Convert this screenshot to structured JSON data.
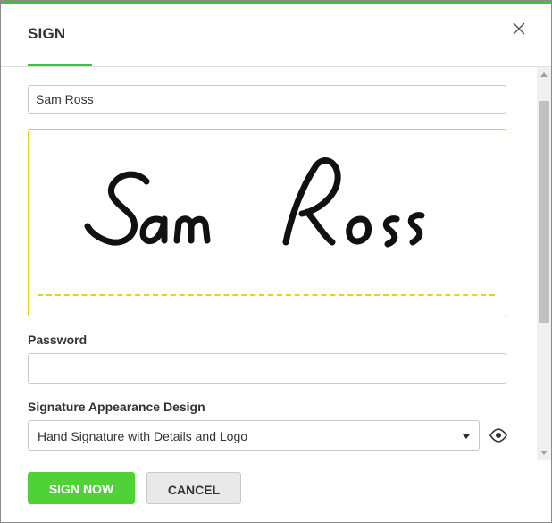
{
  "dialog": {
    "title": "SIGN",
    "close_icon": "close-icon",
    "accent_color": "#3cc33c"
  },
  "signer": {
    "name_value": "Sam Ross"
  },
  "signature_pad": {
    "rendered_text": "Sam Ross",
    "border_color": "#e6d21e"
  },
  "password": {
    "label": "Password",
    "value": ""
  },
  "appearance": {
    "label": "Signature Appearance Design",
    "selected": "Hand Signature with Details and Logo",
    "preview_icon": "eye-icon"
  },
  "buttons": {
    "sign_label": "SIGN NOW",
    "cancel_label": "CANCEL",
    "sign_color": "#4fd237"
  }
}
